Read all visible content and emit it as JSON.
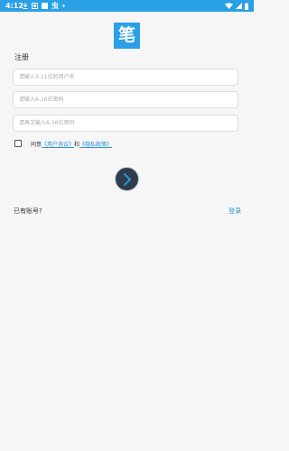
{
  "status_bar": {
    "time": "4:12",
    "notification_icons": [
      "download-icon",
      "app-icon",
      "square-icon",
      "app-icon",
      "dot-icon"
    ],
    "system_icons": [
      "wifi-icon",
      "signal-icon",
      "battery-icon"
    ]
  },
  "logo": {
    "text": "笔",
    "color": "#2aa0e6"
  },
  "form": {
    "title": "注册",
    "username_placeholder": "请输入3-11位的用户名",
    "password_placeholder": "请输入6-16位密码",
    "confirm_placeholder": "请再次输入6-16位密码"
  },
  "agreement": {
    "prefix": "同意",
    "user_agreement": "《用户协议》",
    "conjunction": "和",
    "privacy_policy": "《隐私政策》",
    "checked": false
  },
  "footer": {
    "have_account": "已有账号?",
    "login_label": "登录"
  },
  "colors": {
    "accent": "#2aa0e6",
    "button_bg": "#2f3e4e",
    "link": "#2a8fd6"
  }
}
